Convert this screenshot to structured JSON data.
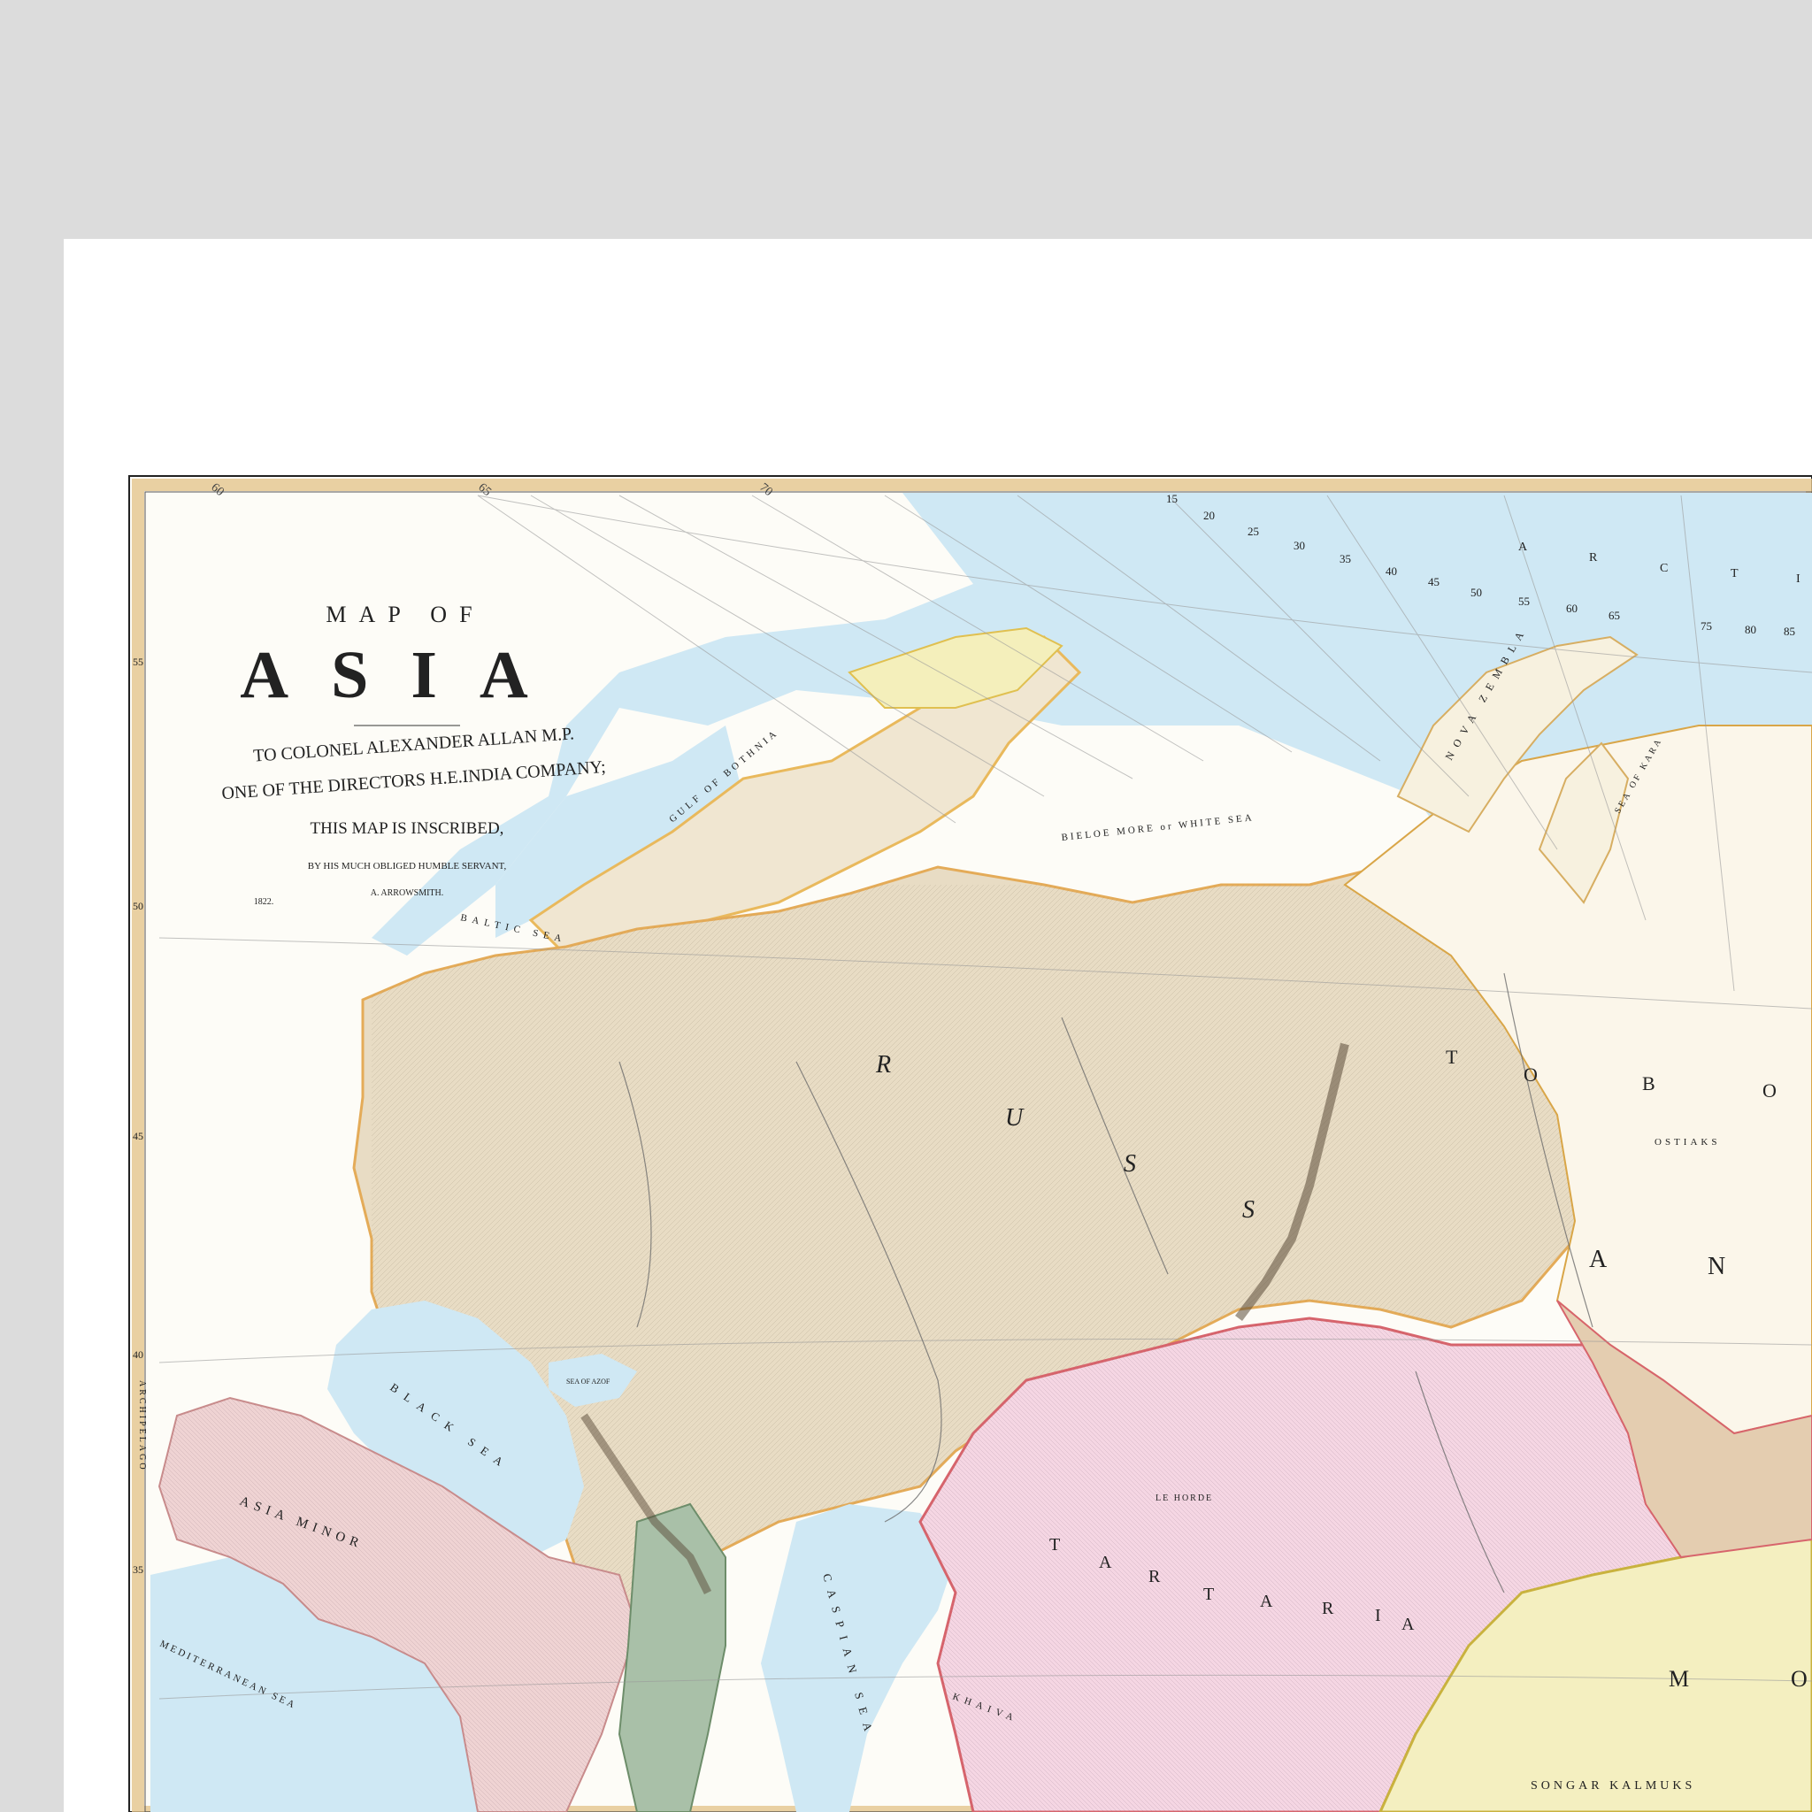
{
  "cartouche": {
    "line1": "MAP OF",
    "title": "ASIA",
    "dedication1": "TO COLONEL ALEXANDER ALLAN M.P.",
    "dedication2": "ONE OF THE DIRECTORS H.E.INDIA COMPANY;",
    "dedication3": "THIS MAP IS INSCRIBED,",
    "servant": "BY HIS MUCH OBLIGED HUMBLE SERVANT,",
    "author": "A. ARROWSMITH.",
    "date": "1822."
  },
  "seas": {
    "arctic": [
      "A",
      "R",
      "C",
      "T",
      "I"
    ],
    "baltic": "BALTIC SEA",
    "gulf": "GULF OF BOTHNIA",
    "white_sea": "BIELOE MORE or WHITE SEA",
    "black": "BLACK SEA",
    "mediterranean": "MEDITERRANEAN SEA",
    "caspian": "CASPIAN SEA",
    "kara": "SEA OF KARA",
    "azof": "SEA OF AZOF",
    "archipelago": "ARCHIPELAGO"
  },
  "regions": {
    "russia": [
      "R",
      "U",
      "S",
      "S"
    ],
    "tobolsk": [
      "T",
      "O",
      "B",
      "O"
    ],
    "ostiaks": "OSTIAKS",
    "an": [
      "A",
      "N"
    ],
    "tartaria": [
      "T",
      "A",
      "R",
      "T",
      "A",
      "R",
      "I",
      "A"
    ],
    "asia_minor": "ASIA MINOR",
    "kalmuks": "SONGAR KALMUKS",
    "mo": [
      "M",
      "O"
    ],
    "khiva": "KHAIVA",
    "horde": "LE HORDE",
    "nova_zembla": "NOVA ZEMBLA"
  },
  "graticule": {
    "top_degrees": [
      "60",
      "65",
      "70"
    ],
    "arc_degrees": [
      "15",
      "20",
      "25",
      "30",
      "35",
      "40",
      "45",
      "50",
      "55",
      "60",
      "65",
      "75",
      "80",
      "85"
    ],
    "left_degrees": [
      "55",
      "50",
      "45",
      "40",
      "35"
    ]
  },
  "colors": {
    "background": "#dcdcdc",
    "paper": "#ffffff",
    "sea": "#cfe8f4",
    "russia": "#e8dcc4",
    "tartary": "#f5d6e3",
    "turkey": "#efd3d3",
    "mongolia": "#f4efc0",
    "border": "#d9a648"
  }
}
